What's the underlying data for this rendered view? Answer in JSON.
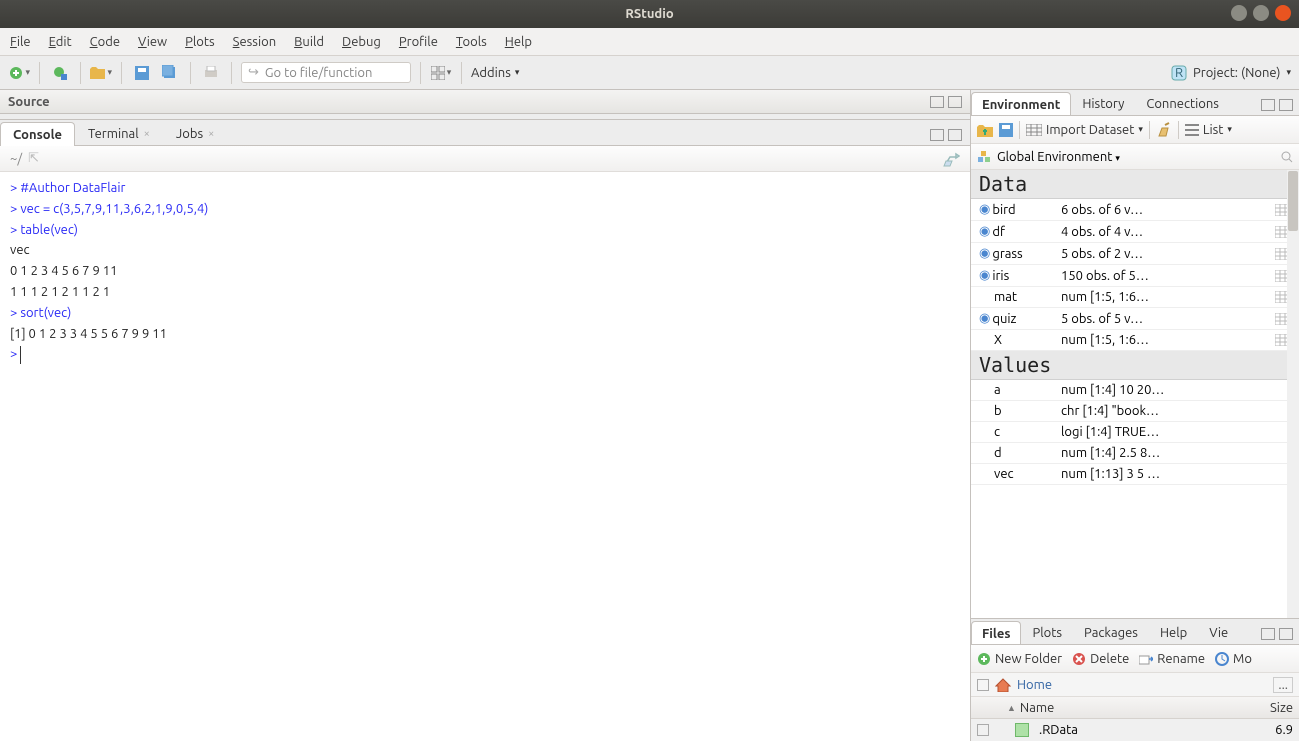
{
  "window": {
    "title": "RStudio"
  },
  "menu": [
    "File",
    "Edit",
    "Code",
    "View",
    "Plots",
    "Session",
    "Build",
    "Debug",
    "Profile",
    "Tools",
    "Help"
  ],
  "toolbar": {
    "goto_placeholder": "Go to file/function",
    "addins": "Addins",
    "project_label": "Project: (None)"
  },
  "source": {
    "title": "Source"
  },
  "console_tabs": {
    "console": "Console",
    "terminal": "Terminal",
    "jobs": "Jobs"
  },
  "console_prompt_path": "~/",
  "console_lines": [
    {
      "type": "input",
      "text": "#Author DataFlair"
    },
    {
      "type": "input",
      "text": "vec = c(3,5,7,9,11,3,6,2,1,9,0,5,4)"
    },
    {
      "type": "input",
      "text": "table(vec)"
    },
    {
      "type": "output",
      "text": "vec"
    },
    {
      "type": "output",
      "text": " 0  1  2  3  4  5  6  7  9 11 "
    },
    {
      "type": "output",
      "text": " 1  1  1  2  1  2  1  1  2  1 "
    },
    {
      "type": "input",
      "text": "sort(vec)"
    },
    {
      "type": "output",
      "text": " [1]  0  1  2  3  3  4  5  5  6  7  9  9 11"
    },
    {
      "type": "prompt_only",
      "text": ""
    }
  ],
  "env_tabs": {
    "environment": "Environment",
    "history": "History",
    "connections": "Connections"
  },
  "env_toolbar": {
    "import": "Import Dataset",
    "list": "List"
  },
  "env_scope": "Global Environment",
  "env_sections": {
    "data_label": "Data",
    "values_label": "Values",
    "data": [
      {
        "name": "bird",
        "val": "6 obs. of 6 v…",
        "expand": true,
        "grid": true
      },
      {
        "name": "df",
        "val": "4 obs. of 4 v…",
        "expand": true,
        "grid": true
      },
      {
        "name": "grass",
        "val": "5 obs. of 2 v…",
        "expand": true,
        "grid": true
      },
      {
        "name": "iris",
        "val": "150 obs. of 5…",
        "expand": true,
        "grid": true
      },
      {
        "name": "mat",
        "val": "num [1:5, 1:6…",
        "expand": false,
        "grid": true
      },
      {
        "name": "quiz",
        "val": "5 obs. of 5 v…",
        "expand": true,
        "grid": true
      },
      {
        "name": "X",
        "val": "num [1:5, 1:6…",
        "expand": false,
        "grid": true
      }
    ],
    "values": [
      {
        "name": "a",
        "val": "num [1:4] 10 20…"
      },
      {
        "name": "b",
        "val": "chr [1:4] \"book…"
      },
      {
        "name": "c",
        "val": "logi [1:4] TRUE…"
      },
      {
        "name": "d",
        "val": "num [1:4] 2.5 8…"
      },
      {
        "name": "vec",
        "val": "num [1:13] 3 5 …"
      }
    ]
  },
  "files_tabs": {
    "files": "Files",
    "plots": "Plots",
    "packages": "Packages",
    "help": "Help",
    "viewer": "Vie"
  },
  "files_toolbar": {
    "new": "New Folder",
    "delete": "Delete",
    "rename": "Rename",
    "more": "Mo"
  },
  "breadcrumb": {
    "home": "Home"
  },
  "file_header": {
    "name": "Name",
    "size": "Size",
    "up": "▲"
  },
  "files": [
    {
      "name": ".RData",
      "size": "6.9"
    }
  ]
}
